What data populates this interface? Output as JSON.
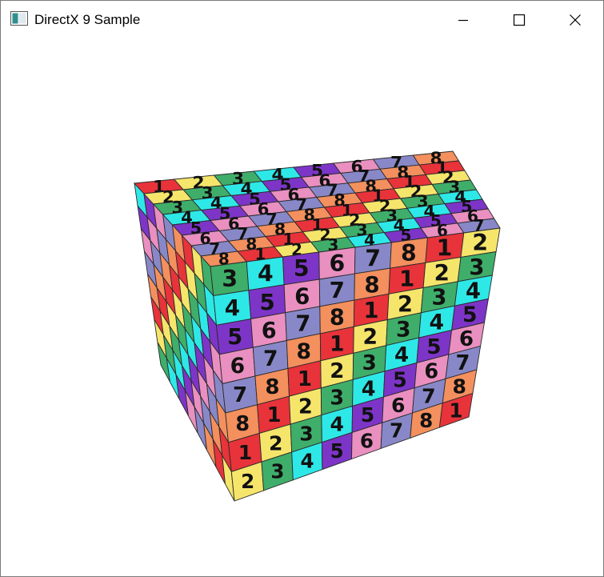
{
  "window": {
    "title": "DirectX 9 Sample"
  },
  "caption_buttons": [
    {
      "name": "minimize",
      "icon": "minimize-icon"
    },
    {
      "name": "maximize",
      "icon": "maximize-icon"
    },
    {
      "name": "close",
      "icon": "close-icon"
    }
  ],
  "scene": {
    "object": "cube",
    "grid": 8,
    "tile_digits": [
      "1",
      "2",
      "3",
      "4",
      "5",
      "6",
      "7",
      "8"
    ],
    "palette": [
      "#e8333a",
      "#f5e56b",
      "#3fae6a",
      "#2ee8e8",
      "#7d35c7",
      "#e990c0",
      "#8888c8",
      "#f3905e"
    ]
  }
}
